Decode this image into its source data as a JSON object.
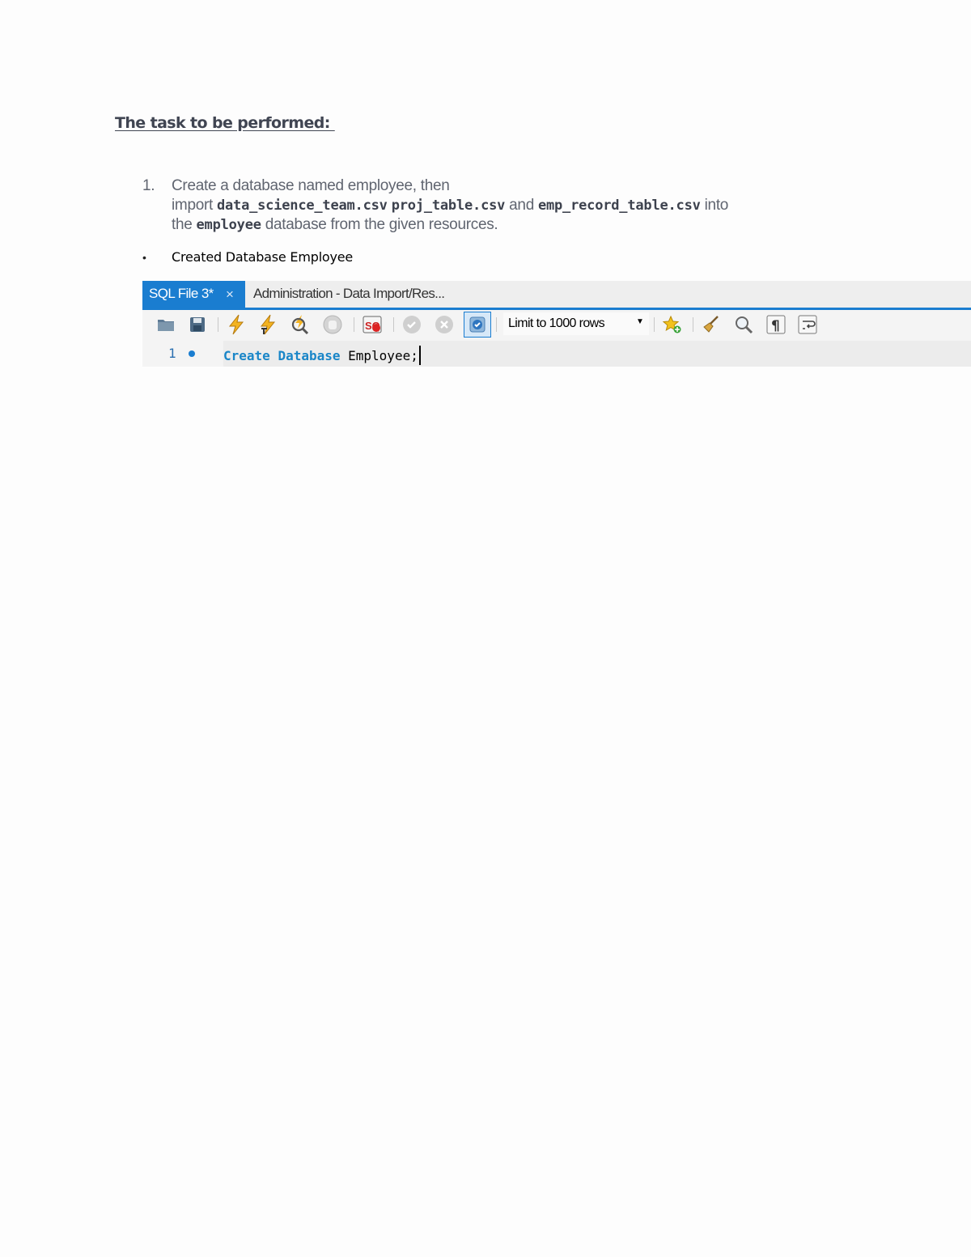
{
  "heading": "The task to be performed: ",
  "task": {
    "number": "1.",
    "line1": "Create a database named employee, then",
    "line2_prefix": "import ",
    "file1": "data_science_team.csv",
    "file2": "proj_table.csv",
    "and": " and ",
    "file3": "emp_record_table.csv",
    "line2_suffix": " into",
    "line3_prefix": "the ",
    "db_name": "employee",
    "line3_suffix": " database from the given resources."
  },
  "bullet": {
    "glyph": "•",
    "text": "Created Database Employee"
  },
  "editor_screenshot": {
    "tabs": [
      {
        "label": "SQL File 3*",
        "close": "×",
        "active": true
      },
      {
        "label": "Administration - Data Import/Res...",
        "active": false
      }
    ],
    "toolbar": {
      "icons": [
        "open-folder-icon",
        "save-icon",
        "execute-lightning-icon",
        "execute-current-lightning-icon",
        "explain-magnifier-icon",
        "stop-hand-icon",
        "toggle-stop-on-error-icon",
        "commit-check-icon",
        "rollback-x-icon",
        "auto-commit-toggle-icon",
        "add-snippet-star-icon",
        "beautify-broom-icon",
        "find-magnifier-icon",
        "invisible-chars-pilcrow-icon",
        "word-wrap-icon"
      ],
      "limit_select": "Limit to 1000 rows"
    },
    "code": {
      "line_number": "1",
      "keyword1": "Create",
      "keyword2": "Database",
      "identifier": "Employee",
      "terminator": ";"
    },
    "colors": {
      "accent": "#1a7dd0",
      "keyword": "#1a86c8"
    }
  }
}
